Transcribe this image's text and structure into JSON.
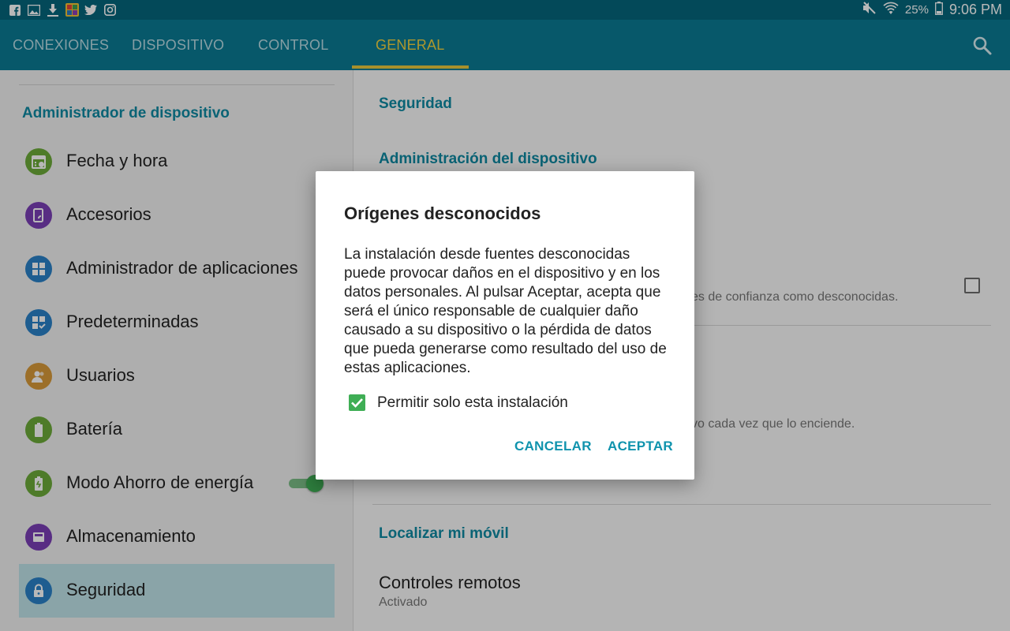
{
  "status_bar": {
    "notification_icons": [
      "facebook-icon",
      "image-icon",
      "download-icon",
      "game-app-icon",
      "twitter-icon",
      "instagram-icon"
    ],
    "battery_percent": "25%",
    "time": "9:06 PM"
  },
  "tabs": [
    {
      "label": "CONEXIONES",
      "active": false
    },
    {
      "label": "DISPOSITIVO",
      "active": false
    },
    {
      "label": "CONTROL",
      "active": false
    },
    {
      "label": "GENERAL",
      "active": true
    }
  ],
  "sidebar": {
    "section_title": "Administrador de dispositivo",
    "items": [
      {
        "label": "Fecha y hora",
        "icon": "calendar-icon",
        "color": "#6cab3a"
      },
      {
        "label": "Accesorios",
        "icon": "accessories-icon",
        "color": "#7b3fb6"
      },
      {
        "label": "Administrador de aplicaciones",
        "icon": "apps-grid-icon",
        "color": "#2a82c8"
      },
      {
        "label": "Predeterminadas",
        "icon": "default-apps-icon",
        "color": "#2a82c8"
      },
      {
        "label": "Usuarios",
        "icon": "users-icon",
        "color": "#d99a3a"
      },
      {
        "label": "Batería",
        "icon": "battery-icon",
        "color": "#6cab3a"
      },
      {
        "label": "Modo Ahorro de energía",
        "icon": "power-saving-icon",
        "color": "#6cab3a",
        "toggle_on": true
      },
      {
        "label": "Almacenamiento",
        "icon": "storage-icon",
        "color": "#7b3fb6"
      },
      {
        "label": "Seguridad",
        "icon": "lock-icon",
        "color": "#2a82c8",
        "selected": true
      }
    ]
  },
  "content": {
    "page_title": "Seguridad",
    "section_device_admin": "Administración del dispositivo",
    "unknown_sources_subtitle_fragment": "es de confianza como desconocidas.",
    "secure_startup_subtitle_fragment": "vo cada vez que lo enciende.",
    "section_find_my_mobile": "Localizar mi móvil",
    "remote_controls_title": "Controles remotos",
    "remote_controls_status": "Activado"
  },
  "dialog": {
    "title": "Orígenes desconocidos",
    "message": "La instalación desde fuentes desconocidas puede provocar daños en el dispositivo y en los datos personales. Al pulsar Aceptar, acepta que será el único responsable de cualquier daño causado a su dispositivo o la pérdida de datos que pueda generarse como resultado del uso de estas aplicaciones.",
    "checkbox_label": "Permitir solo esta instalación",
    "checkbox_checked": true,
    "cancel_label": "CANCELAR",
    "accept_label": "ACEPTAR"
  },
  "colors": {
    "status_bar": "#05667c",
    "tab_bar": "#0a7b94",
    "active_tab": "#f2d23f",
    "accent_text": "#0f8aa3",
    "checkbox_green": "#3fae55"
  }
}
